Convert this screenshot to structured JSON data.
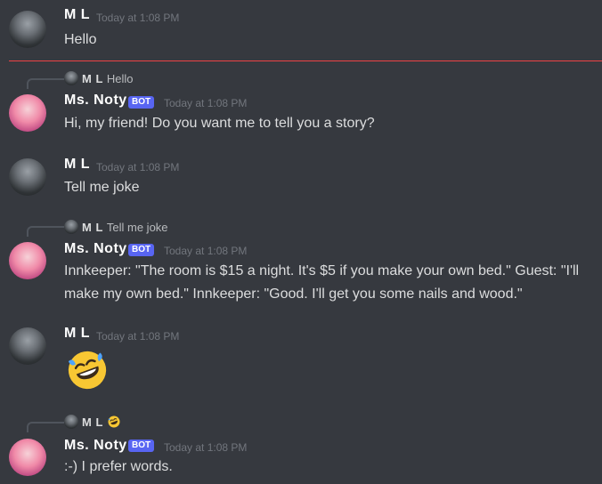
{
  "messages": [
    {
      "author": "M L",
      "timestamp": "Today at 1:08 PM",
      "text": "Hello"
    },
    {
      "reply_to": {
        "author": "M L",
        "text": "Hello"
      },
      "author": "Ms. Noty",
      "badge": "BOT",
      "timestamp": "Today at 1:08 PM",
      "text": "Hi, my friend! Do you want me to tell you a story?"
    },
    {
      "author": "M L",
      "timestamp": "Today at 1:08 PM",
      "text": "Tell me joke"
    },
    {
      "reply_to": {
        "author": "M L",
        "text": "Tell me joke"
      },
      "author": "Ms. Noty",
      "badge": "BOT",
      "timestamp": "Today at 1:08 PM",
      "text_line1": "Innkeeper: \"The room is $15 a night. It's $5 if you make your own bed.\" Guest: \"I'll",
      "text_line2": "make my own bed.\" Innkeeper: \"Good. I'll get you some nails and wood.\""
    },
    {
      "author": "M L",
      "timestamp": "Today at 1:08 PM",
      "emoji": "rolling-on-floor-laughing"
    },
    {
      "reply_to": {
        "author": "M L",
        "emoji": "rolling-on-floor-laughing"
      },
      "author": "Ms. Noty",
      "badge": "BOT",
      "timestamp": "Today at 1:08 PM",
      "text": ":-) I prefer words."
    }
  ]
}
